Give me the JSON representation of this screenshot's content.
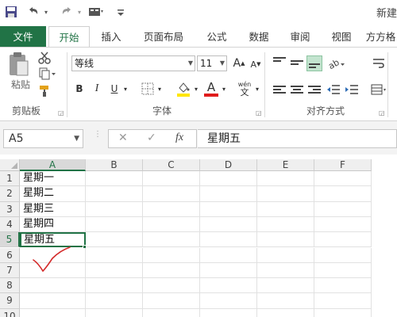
{
  "app": {
    "title": "新建"
  },
  "colors": {
    "accent": "#217346",
    "file_tab": "#217346",
    "tick": "#d42b2b"
  },
  "quick_access": {
    "icons": [
      "save-icon",
      "undo-icon",
      "redo-icon",
      "sort-icon",
      "customize-icon"
    ]
  },
  "tabs": [
    {
      "label": "文件"
    },
    {
      "label": "开始"
    },
    {
      "label": "插入"
    },
    {
      "label": "页面布局"
    },
    {
      "label": "公式"
    },
    {
      "label": "数据"
    },
    {
      "label": "审阅"
    },
    {
      "label": "视图"
    },
    {
      "label": "方方格"
    }
  ],
  "ribbon": {
    "clipboard": {
      "label": "剪贴板",
      "paste_label": "粘贴"
    },
    "font": {
      "label": "字体",
      "font_name": "等线",
      "font_size": "11",
      "grow": "A",
      "shrink": "A",
      "bold": "B",
      "italic": "I",
      "underline": "U",
      "font_color_glyph": "A",
      "wen_label": "wén",
      "wen_char": "文"
    },
    "alignment": {
      "label": "对齐方式"
    }
  },
  "formula_bar": {
    "name_box": "A5",
    "cancel": "✕",
    "enter": "✓",
    "fx": "fx",
    "content": "星期五"
  },
  "sheet": {
    "columns": [
      "A",
      "B",
      "C",
      "D",
      "E",
      "F"
    ],
    "rows": [
      "1",
      "2",
      "3",
      "4",
      "5",
      "6",
      "7",
      "8",
      "9",
      "10"
    ],
    "cells": {
      "A1": "星期一",
      "A2": "星期二",
      "A3": "星期三",
      "A4": "星期四",
      "A5": "星期五"
    },
    "active_cell": "A5"
  }
}
